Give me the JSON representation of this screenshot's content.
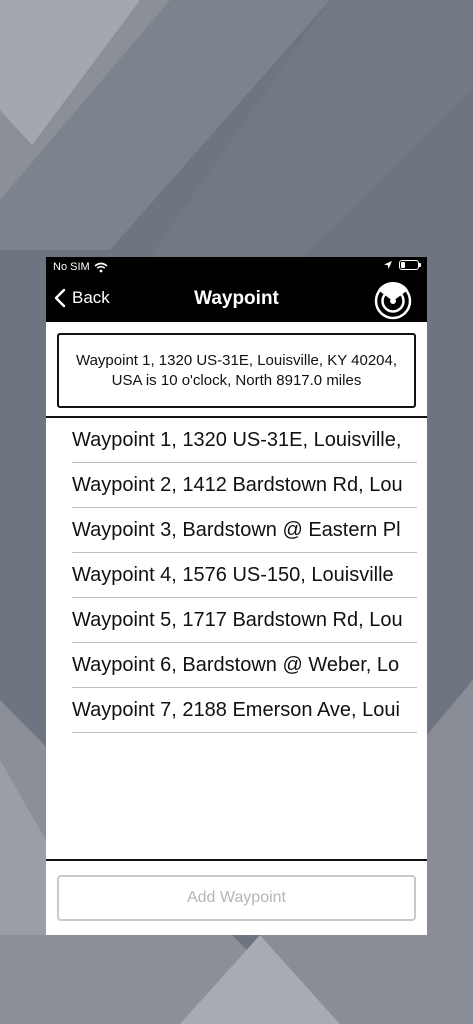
{
  "status_bar": {
    "carrier": "No SIM"
  },
  "nav": {
    "back_label": "Back",
    "title": "Waypoint"
  },
  "info": {
    "text": "Waypoint 1, 1320 US-31E, Louisville, KY 40204, USA is 10 o'clock, North 8917.0 miles"
  },
  "waypoints": [
    "Waypoint 1, 1320 US-31E, Louisville,",
    "Waypoint 2, 1412 Bardstown Rd, Lou",
    "Waypoint 3, Bardstown @ Eastern Pl",
    "Waypoint 4, 1576 US-150, Louisville",
    "Waypoint 5, 1717 Bardstown Rd, Lou",
    "Waypoint 6, Bardstown @ Weber, Lo",
    "Waypoint 7, 2188 Emerson Ave, Loui"
  ],
  "footer": {
    "add_label": "Add Waypoint"
  },
  "colors": {
    "background": "#6f7580",
    "bar": "#000000",
    "disabled_text": "#b5b5b5"
  }
}
